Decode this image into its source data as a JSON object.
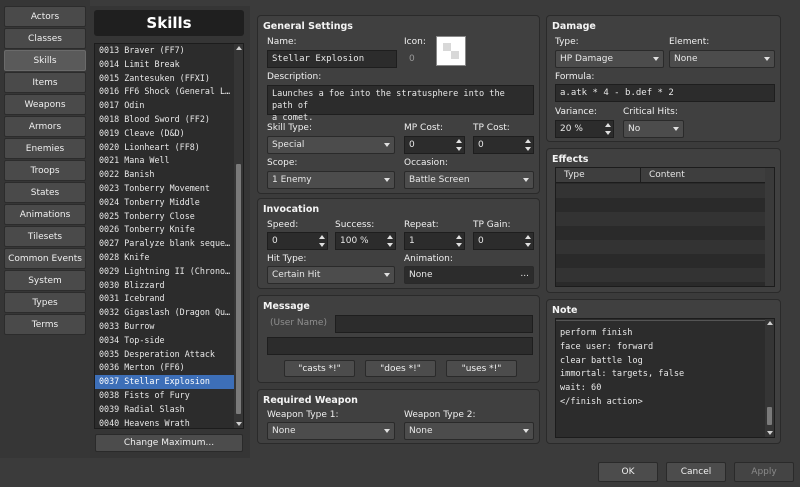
{
  "tabs": [
    {
      "label": "Actors"
    },
    {
      "label": "Classes"
    },
    {
      "label": "Skills"
    },
    {
      "label": "Items"
    },
    {
      "label": "Weapons"
    },
    {
      "label": "Armors"
    },
    {
      "label": "Enemies"
    },
    {
      "label": "Troops"
    },
    {
      "label": "States"
    },
    {
      "label": "Animations"
    },
    {
      "label": "Tilesets"
    },
    {
      "label": "Common Events"
    },
    {
      "label": "System"
    },
    {
      "label": "Types"
    },
    {
      "label": "Terms"
    }
  ],
  "list": {
    "title": "Skills",
    "selected_index": 24,
    "items": [
      "0013 Braver (FF7)",
      "0014 Limit Break",
      "0015 Zantesuken (FFXI)",
      "0016 FF6 Shock (General L…",
      "0017 Odin",
      "0018 Blood Sword (FF2)",
      "0019 Cleave (D&D)",
      "0020 Lionheart (FF8)",
      "0021 Mana Well",
      "0022 Banish",
      "0023 Tonberry Movement",
      "0024 Tonberry Middle",
      "0025 Tonberry Close",
      "0026 Tonberry Knife",
      "0027 Paralyze blank seque…",
      "0028 Knife",
      "0029 Lightning II (Chrono…",
      "0030 Blizzard",
      "0031 Icebrand",
      "0032 Gigaslash (Dragon Qu…",
      "0033 Burrow",
      "0034 Top-side",
      "0035 Desperation Attack",
      "0036 Merton (FF6)",
      "0037 Stellar Explosion",
      "0038 Fists of Fury",
      "0039 Radial Slash",
      "0040 Heavens Wrath"
    ],
    "change_max_label": "Change Maximum..."
  },
  "general": {
    "title": "General Settings",
    "name_label": "Name:",
    "name_value": "Stellar Explosion",
    "icon_label": "Icon:",
    "icon_index": "0",
    "desc_label": "Description:",
    "desc_line1": "Launches a foe into the stratusphere into the path of",
    "desc_line2": "a comet.",
    "skill_type_label": "Skill Type:",
    "skill_type_value": "Special",
    "mp_cost_label": "MP Cost:",
    "mp_cost_value": "0",
    "tp_cost_label": "TP Cost:",
    "tp_cost_value": "0",
    "scope_label": "Scope:",
    "scope_value": "1 Enemy",
    "occasion_label": "Occasion:",
    "occasion_value": "Battle Screen"
  },
  "invocation": {
    "title": "Invocation",
    "speed_label": "Speed:",
    "speed_value": "0",
    "success_label": "Success:",
    "success_value": "100 %",
    "repeat_label": "Repeat:",
    "repeat_value": "1",
    "tp_gain_label": "TP Gain:",
    "tp_gain_value": "0",
    "hit_type_label": "Hit Type:",
    "hit_type_value": "Certain Hit",
    "animation_label": "Animation:",
    "animation_value": "None",
    "animation_button": "..."
  },
  "message": {
    "title": "Message",
    "user_name_placeholder": "(User Name)",
    "btn_casts": "\"casts *!\"",
    "btn_does": "\"does *!\"",
    "btn_uses": "\"uses *!\""
  },
  "required_weapon": {
    "title": "Required Weapon",
    "type1_label": "Weapon Type 1:",
    "type1_value": "None",
    "type2_label": "Weapon Type 2:",
    "type2_value": "None"
  },
  "damage": {
    "title": "Damage",
    "type_label": "Type:",
    "type_value": "HP Damage",
    "element_label": "Element:",
    "element_value": "None",
    "formula_label": "Formula:",
    "formula_value": "a.atk * 4 - b.def * 2",
    "variance_label": "Variance:",
    "variance_value": "20 %",
    "critical_label": "Critical Hits:",
    "critical_value": "No"
  },
  "effects": {
    "title": "Effects",
    "col_type": "Type",
    "col_content": "Content"
  },
  "note": {
    "title": "Note",
    "lines": [
      "perform finish",
      "face user: forward",
      "clear battle log",
      "immortal: targets, false",
      "wait: 60",
      "</finish action>"
    ]
  },
  "footer": {
    "ok": "OK",
    "cancel": "Cancel",
    "apply": "Apply"
  }
}
